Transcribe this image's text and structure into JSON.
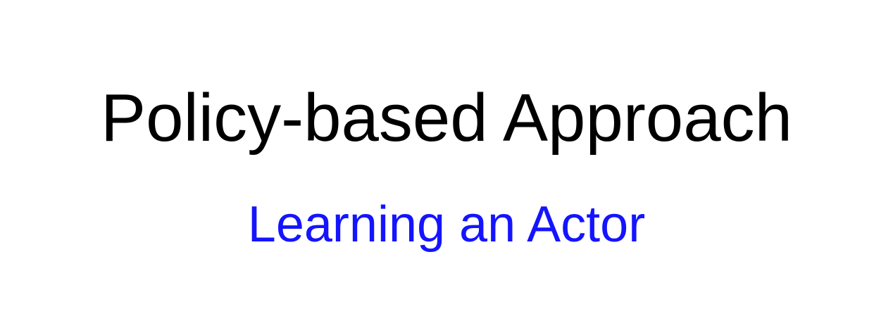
{
  "slide": {
    "title": "Policy-based Approach",
    "subtitle": "Learning an Actor"
  },
  "colors": {
    "background": "#ffffff",
    "title": "#000000",
    "subtitle": "#1414ff"
  }
}
